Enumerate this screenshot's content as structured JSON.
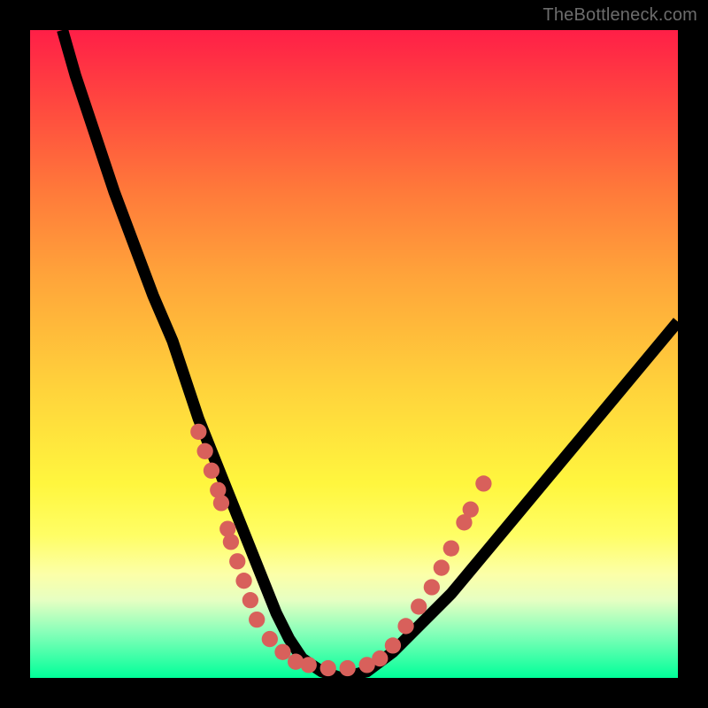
{
  "watermark": "TheBottleneck.com",
  "colors": {
    "background": "#000000",
    "curve_stroke": "#000000",
    "dot_fill": "#d8605b",
    "gradient_top": "#ff1f47",
    "gradient_bottom": "#00ff99"
  },
  "chart_data": {
    "type": "line",
    "title": "",
    "xlabel": "",
    "ylabel": "",
    "xlim": [
      0,
      100
    ],
    "ylim": [
      0,
      100
    ],
    "series": [
      {
        "name": "bottleneck-curve",
        "x": [
          5,
          7,
          10,
          13,
          16,
          19,
          22,
          24,
          26,
          28,
          30,
          32,
          34,
          36,
          38,
          40,
          42,
          45,
          48,
          52,
          56,
          60,
          65,
          70,
          75,
          80,
          85,
          90,
          95,
          100
        ],
        "y": [
          100,
          93,
          84,
          75,
          67,
          59,
          52,
          46,
          40,
          35,
          30,
          25,
          20,
          15,
          10,
          6,
          3,
          1,
          0,
          1,
          4,
          8,
          13,
          19,
          25,
          31,
          37,
          43,
          49,
          55
        ]
      }
    ],
    "dots": [
      {
        "x": 26,
        "y": 38
      },
      {
        "x": 27,
        "y": 35
      },
      {
        "x": 28,
        "y": 32
      },
      {
        "x": 29,
        "y": 29
      },
      {
        "x": 29.5,
        "y": 27
      },
      {
        "x": 30.5,
        "y": 23
      },
      {
        "x": 31,
        "y": 21
      },
      {
        "x": 32,
        "y": 18
      },
      {
        "x": 33,
        "y": 15
      },
      {
        "x": 34,
        "y": 12
      },
      {
        "x": 35,
        "y": 9
      },
      {
        "x": 37,
        "y": 6
      },
      {
        "x": 39,
        "y": 4
      },
      {
        "x": 41,
        "y": 2.5
      },
      {
        "x": 43,
        "y": 2
      },
      {
        "x": 46,
        "y": 1.5
      },
      {
        "x": 49,
        "y": 1.5
      },
      {
        "x": 52,
        "y": 2
      },
      {
        "x": 54,
        "y": 3
      },
      {
        "x": 56,
        "y": 5
      },
      {
        "x": 58,
        "y": 8
      },
      {
        "x": 60,
        "y": 11
      },
      {
        "x": 62,
        "y": 14
      },
      {
        "x": 63.5,
        "y": 17
      },
      {
        "x": 65,
        "y": 20
      },
      {
        "x": 67,
        "y": 24
      },
      {
        "x": 68,
        "y": 26
      },
      {
        "x": 70,
        "y": 30
      }
    ]
  }
}
